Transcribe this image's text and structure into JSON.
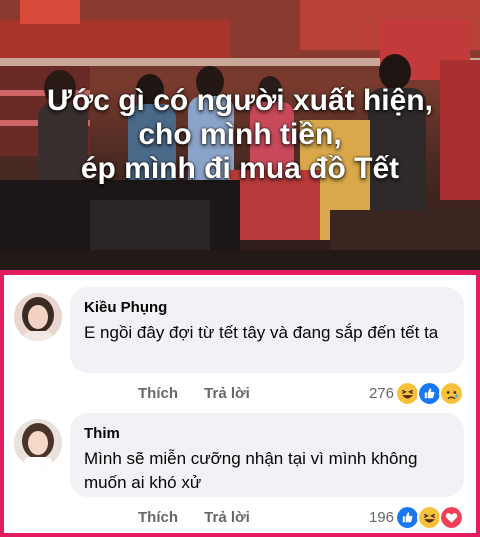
{
  "banner": {
    "caption_lines": [
      "Ước gì có người xuất hiện,",
      "cho mình tiền,",
      "ép mình đi mua đồ Tết"
    ]
  },
  "comments": [
    {
      "author": "Kiều Phụng",
      "text": "E ngồi đây đợi từ tết tây và đang sắp đến tết ta",
      "like_label": "Thích",
      "reply_label": "Trả lời",
      "reaction_count": "276",
      "reactions": [
        "haha",
        "like",
        "sad"
      ]
    },
    {
      "author": "Thim",
      "text": "Mình sẽ miễn cưỡng nhận tại vì mình không muốn ai khó xử",
      "like_label": "Thích",
      "reply_label": "Trả lời",
      "reaction_count": "196",
      "reactions": [
        "like",
        "haha",
        "love"
      ]
    }
  ],
  "colors": {
    "frame_border": "#e21b63",
    "bubble_bg": "#f0f2f5",
    "meta_text": "#65676b"
  }
}
